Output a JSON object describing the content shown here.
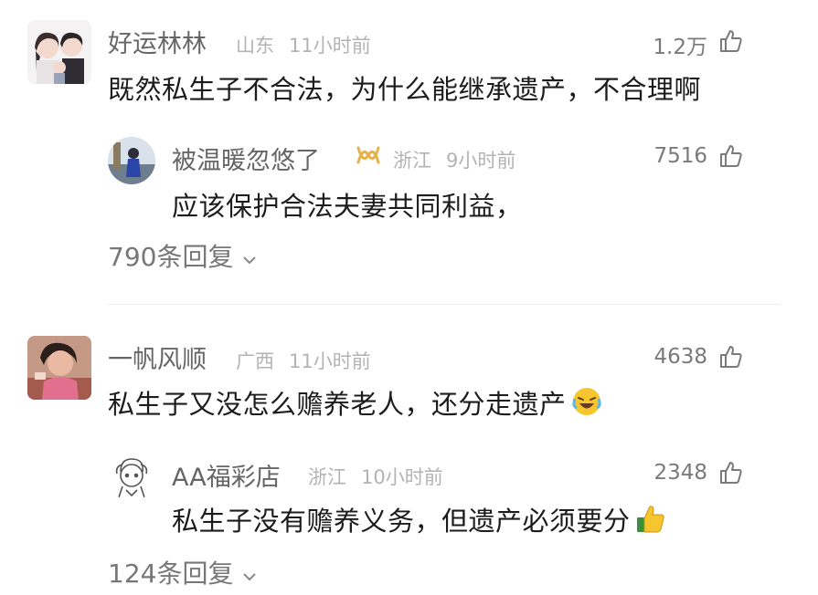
{
  "comments": [
    {
      "user": "好运林林",
      "location": "山东",
      "time": "11小时前",
      "likes": "1.2万",
      "text": "既然私生子不合法，为什么能继承遗产，不合理啊",
      "reply": {
        "user": "被温暖忽悠了",
        "location": "浙江",
        "time": "9小时前",
        "likes": "7516",
        "text": "应该保护合法夫妻共同利益，"
      },
      "more_replies": "790条回复"
    },
    {
      "user": "一帆风顺",
      "location": "广西",
      "time": "11小时前",
      "likes": "4638",
      "text": "私生子又没怎么赡养老人，还分走遗产",
      "reply": {
        "user": "AA福彩店",
        "location": "浙江",
        "time": "10小时前",
        "likes": "2348",
        "text": "私生子没有赡养义务，但遗产必须要分"
      },
      "more_replies": "124条回复"
    }
  ],
  "icons": {
    "like": "thumbs-up-outline-icon",
    "badge": "gold-infinity-badge-icon",
    "emoji_laugh": "laugh-crying-emoji-icon",
    "emoji_thumb": "thumbs-up-emoji-icon",
    "chevron": "chevron-down-icon"
  },
  "colors": {
    "badge": "#e6b14b",
    "emoji": "#f7c62f",
    "muted": "#b3b3b3"
  }
}
